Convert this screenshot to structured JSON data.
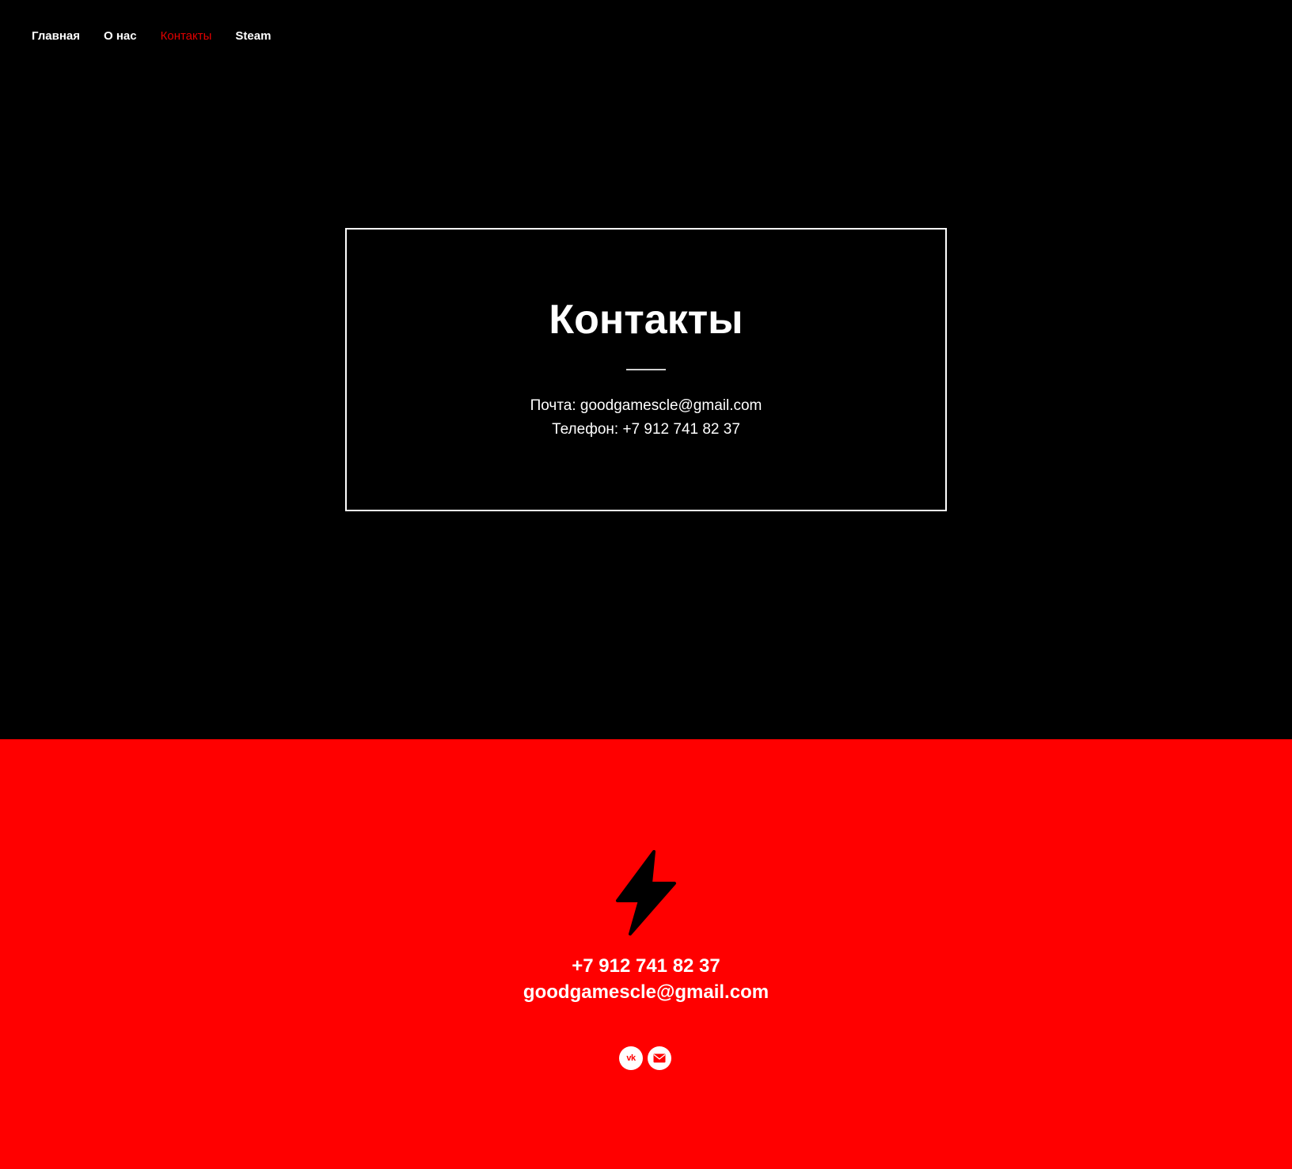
{
  "nav": {
    "items": [
      {
        "label": "Главная",
        "active": false
      },
      {
        "label": "О нас",
        "active": false
      },
      {
        "label": "Контакты",
        "active": true
      },
      {
        "label": "Steam",
        "active": false
      }
    ]
  },
  "contacts_card": {
    "title": "Контакты",
    "email_line": "Почта: goodgamescle@gmail.com",
    "phone_line": "Телефон: +7 912 741 82 37"
  },
  "footer": {
    "logo_icon": "lightning-bolt-icon",
    "phone": "+7 912 741 82 37",
    "email": "goodgamescle@gmail.com",
    "socials": [
      {
        "icon": "vk-icon",
        "glyph": "vk"
      },
      {
        "icon": "mail-icon"
      }
    ]
  },
  "colors": {
    "background": "#000000",
    "accent_red": "#ff0000",
    "nav_active": "#e20000",
    "text": "#ffffff"
  }
}
